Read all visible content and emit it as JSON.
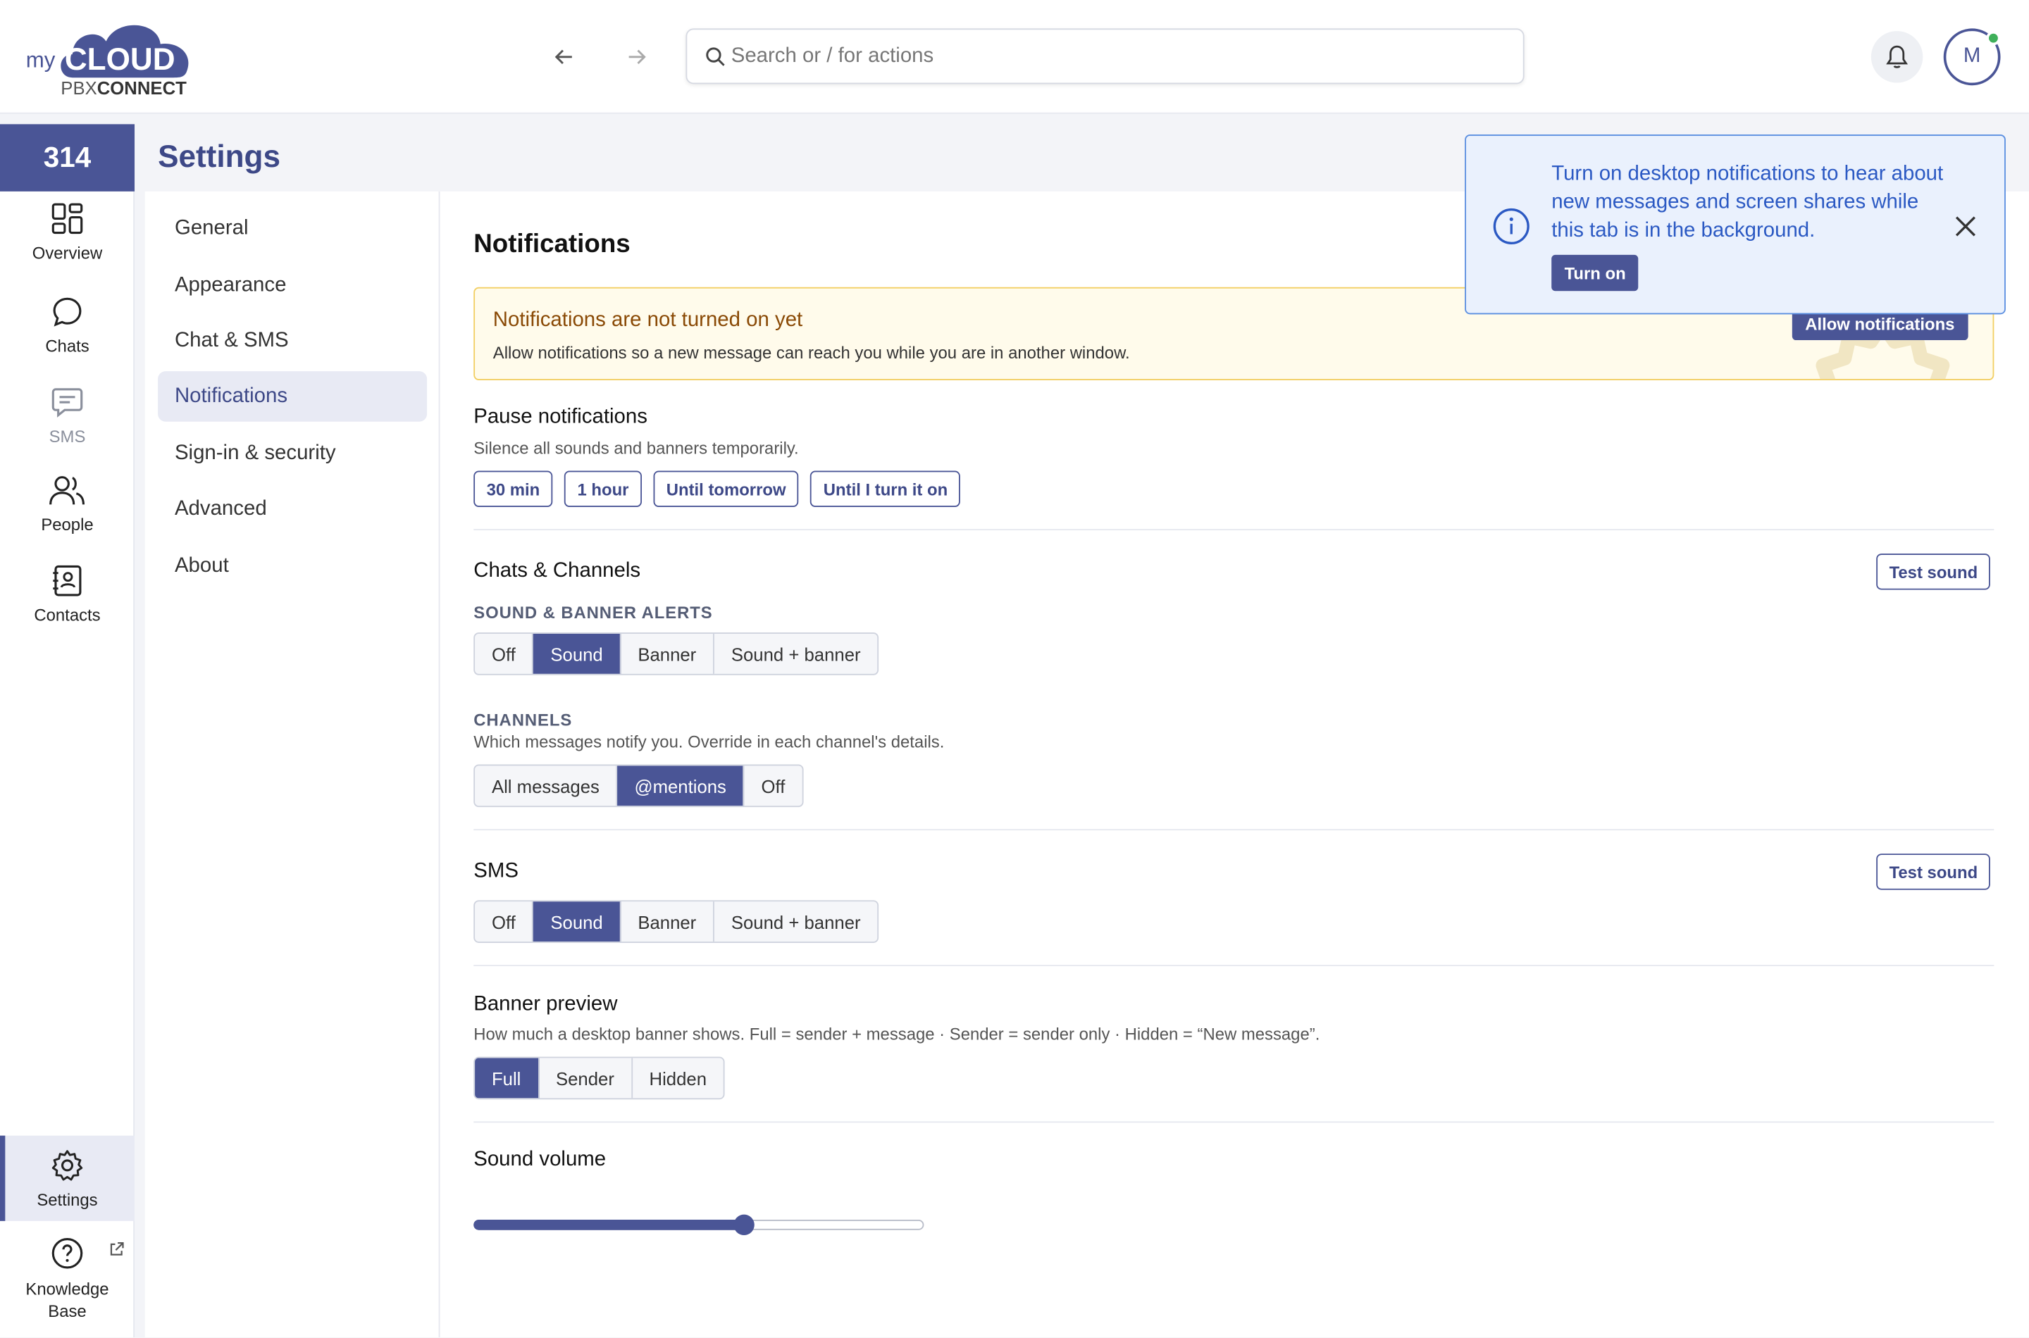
{
  "header": {
    "logo": {
      "prefix": "my",
      "brand": "CLOUD",
      "sub1": "PBX",
      "sub2": "CONNECT"
    },
    "search_placeholder": "Search or / for actions",
    "avatar_initial": "M"
  },
  "rail": {
    "extension": "314",
    "items": [
      {
        "label": "Overview",
        "icon": "overview-icon"
      },
      {
        "label": "Chats",
        "icon": "chat-icon"
      },
      {
        "label": "SMS",
        "icon": "sms-icon"
      },
      {
        "label": "People",
        "icon": "people-icon"
      },
      {
        "label": "Contacts",
        "icon": "contacts-icon"
      }
    ],
    "settings_label": "Settings",
    "knowledge_label_1": "Knowledge",
    "knowledge_label_2": "Base"
  },
  "page_title": "Settings",
  "subnav": [
    "General",
    "Appearance",
    "Chat & SMS",
    "Notifications",
    "Sign-in & security",
    "Advanced",
    "About"
  ],
  "main": {
    "heading": "Notifications",
    "warning": {
      "title": "Notifications are not turned on yet",
      "text": "Allow notifications so a new message can reach you while you are in another window.",
      "button": "Allow notifications"
    },
    "pause": {
      "title": "Pause notifications",
      "sub": "Silence all sounds and banners temporarily.",
      "options": [
        "30 min",
        "1 hour",
        "Until tomorrow",
        "Until I turn it on"
      ]
    },
    "chats": {
      "title": "Chats & Channels",
      "test_sound": "Test sound",
      "alerts_caption": "SOUND & BANNER ALERTS",
      "alerts_options": [
        "Off",
        "Sound",
        "Banner",
        "Sound + banner"
      ],
      "alerts_selected": "Sound",
      "channels_caption": "CHANNELS",
      "channels_sub": "Which messages notify you. Override in each channel's details.",
      "channels_options": [
        "All messages",
        "@mentions",
        "Off"
      ],
      "channels_selected": "@mentions"
    },
    "sms": {
      "title": "SMS",
      "test_sound": "Test sound",
      "options": [
        "Off",
        "Sound",
        "Banner",
        "Sound + banner"
      ],
      "selected": "Sound"
    },
    "banner": {
      "title": "Banner preview",
      "sub": "How much a desktop banner shows. Full = sender + message · Sender = sender only · Hidden = “New message”.",
      "options": [
        "Full",
        "Sender",
        "Hidden"
      ],
      "selected": "Full"
    },
    "volume": {
      "title": "Sound volume",
      "value_percent": 60
    }
  },
  "toast": {
    "message": "Turn on desktop notifications to hear about new messages and screen shares while this tab is in the background.",
    "button": "Turn on"
  },
  "colors": {
    "brand": "#4a5596",
    "warning_bg": "#fffbeb",
    "toast_text": "#2b59c3",
    "online": "#3fb05a"
  }
}
